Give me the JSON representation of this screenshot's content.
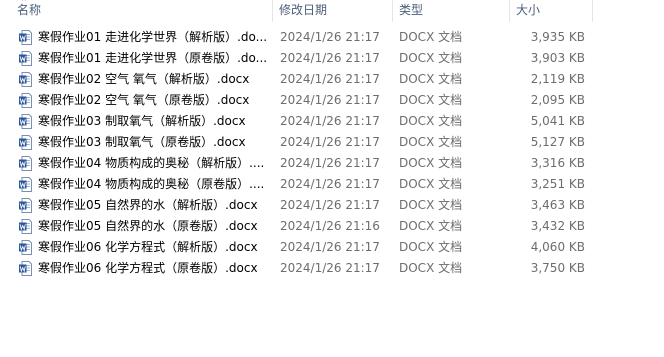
{
  "columns": {
    "name": "名称",
    "modified": "修改日期",
    "type": "类型",
    "size": "大小"
  },
  "icon": "word-document-icon",
  "colors": {
    "header_text": "#4c607a",
    "word_blue": "#2b579a"
  },
  "files": [
    {
      "name": "寒假作业01 走进化学世界（解析版）.do...",
      "date": "2024/1/26 21:17",
      "type": "DOCX 文档",
      "size": "3,935 KB"
    },
    {
      "name": "寒假作业01 走进化学世界（原卷版）.do...",
      "date": "2024/1/26 21:17",
      "type": "DOCX 文档",
      "size": "3,903 KB"
    },
    {
      "name": "寒假作业02 空气  氧气（解析版）.docx",
      "date": "2024/1/26 21:17",
      "type": "DOCX 文档",
      "size": "2,119 KB"
    },
    {
      "name": "寒假作业02 空气  氧气（原卷版）.docx",
      "date": "2024/1/26 21:17",
      "type": "DOCX 文档",
      "size": "2,095 KB"
    },
    {
      "name": "寒假作业03 制取氧气（解析版）.docx",
      "date": "2024/1/26 21:17",
      "type": "DOCX 文档",
      "size": "5,041 KB"
    },
    {
      "name": "寒假作业03 制取氧气（原卷版）.docx",
      "date": "2024/1/26 21:17",
      "type": "DOCX 文档",
      "size": "5,127 KB"
    },
    {
      "name": "寒假作业04 物质构成的奥秘（解析版）....",
      "date": "2024/1/26 21:17",
      "type": "DOCX 文档",
      "size": "3,316 KB"
    },
    {
      "name": "寒假作业04 物质构成的奥秘（原卷版）....",
      "date": "2024/1/26 21:17",
      "type": "DOCX 文档",
      "size": "3,251 KB"
    },
    {
      "name": "寒假作业05 自然界的水（解析版）.docx",
      "date": "2024/1/26 21:17",
      "type": "DOCX 文档",
      "size": "3,463 KB"
    },
    {
      "name": "寒假作业05 自然界的水（原卷版）.docx",
      "date": "2024/1/26 21:16",
      "type": "DOCX 文档",
      "size": "3,432 KB"
    },
    {
      "name": "寒假作业06 化学方程式（解析版）.docx",
      "date": "2024/1/26 21:17",
      "type": "DOCX 文档",
      "size": "4,060 KB"
    },
    {
      "name": "寒假作业06 化学方程式（原卷版）.docx",
      "date": "2024/1/26 21:17",
      "type": "DOCX 文档",
      "size": "3,750 KB"
    }
  ]
}
